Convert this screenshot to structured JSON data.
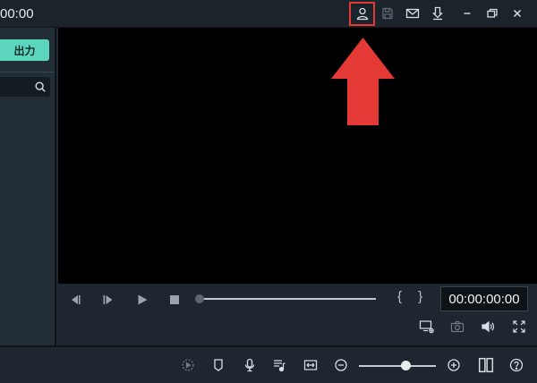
{
  "titlebar": {
    "time_text": "00:00",
    "icons": [
      "account-icon",
      "save-icon",
      "mail-icon",
      "download-icon",
      "minimize-icon",
      "restore-icon",
      "close-icon"
    ]
  },
  "left_panel": {
    "export_label": "出力",
    "search": {
      "value": "",
      "placeholder": ""
    }
  },
  "player": {
    "timecode": "00:00:00:00",
    "mark_in_out": "{ }",
    "progress": 0
  },
  "bottom_bar": {
    "zoom_level": 0.6
  },
  "colors": {
    "accent": "#5cd5be",
    "highlight": "#e53935",
    "arrow": "#e53935"
  }
}
